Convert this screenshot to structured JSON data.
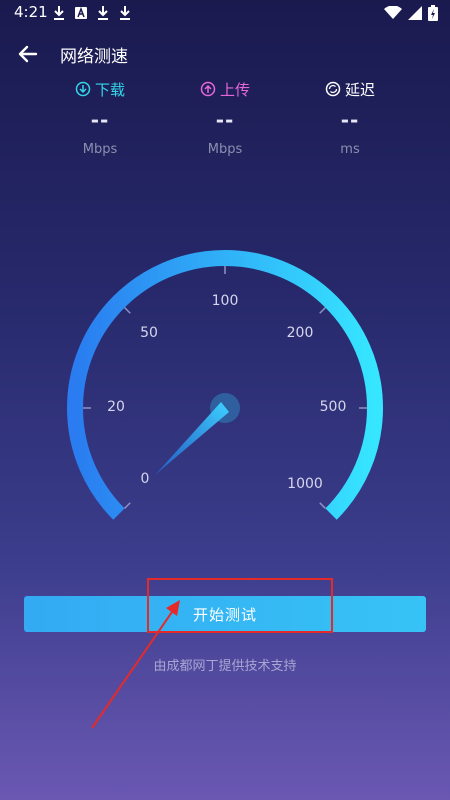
{
  "status_bar": {
    "time": "4:21"
  },
  "header": {
    "title": "网络测速"
  },
  "metrics": [
    {
      "label": "下载",
      "value": "--",
      "unit": "Mbps",
      "color": "#35d6e8",
      "icon": "download-circle-icon"
    },
    {
      "label": "上传",
      "value": "--",
      "unit": "Mbps",
      "color": "#e667d9",
      "icon": "upload-circle-icon"
    },
    {
      "label": "延迟",
      "value": "--",
      "unit": "ms",
      "color": "#ffffff",
      "icon": "latency-icon"
    }
  ],
  "gauge": {
    "scale_labels": [
      "0",
      "20",
      "50",
      "100",
      "200",
      "500",
      "1000"
    ],
    "needle_value": "0",
    "gradient": [
      "#2a7cf0",
      "#36e6ff"
    ]
  },
  "action": {
    "start_label": "开始测试"
  },
  "footer": {
    "credit": "由成都网丁提供技术支持"
  },
  "colors": {
    "accent": "#37c3f5",
    "annotation": "#e52a2a"
  }
}
